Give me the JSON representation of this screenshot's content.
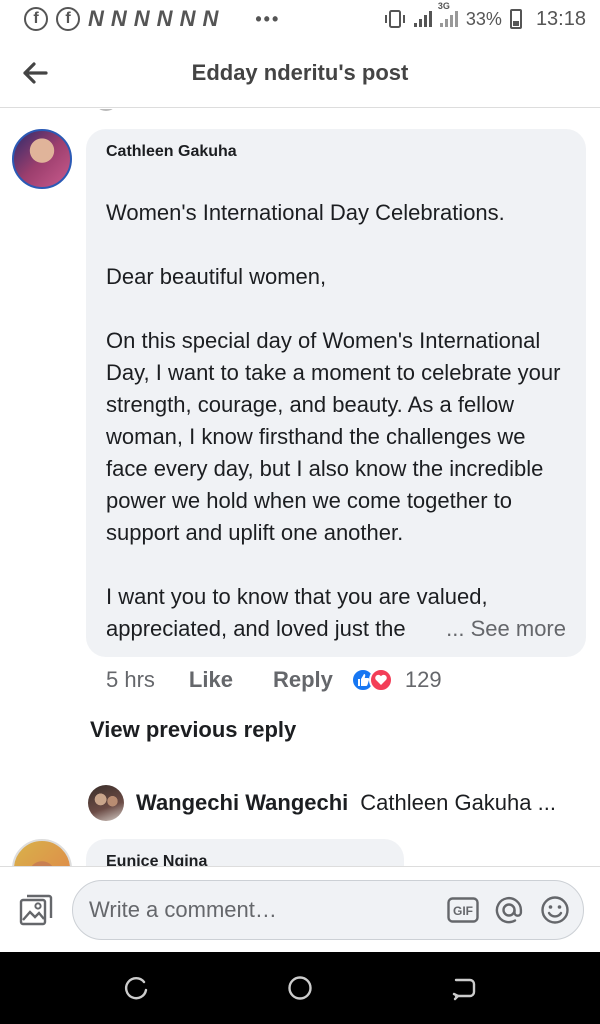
{
  "status_bar": {
    "battery": "33%",
    "time": "13:18",
    "network": "3G",
    "notification_glyphs": [
      "N",
      "N",
      "N",
      "N",
      "N",
      "N",
      "N"
    ]
  },
  "header": {
    "title": "Edday nderitu's post"
  },
  "comment": {
    "author": "Cathleen Gakuha",
    "text": "Women's International Day Celebrations.\n\nDear beautiful women,\n\nOn this special day of Women's International Day, I want to take a moment to celebrate your strength, courage, and beauty. As a fellow woman, I know firsthand the challenges we face every day, but I also know the incredible power we hold when we come together to support and uplift one another.\n\nI want you to know that you are valued, appreciated, and loved just the",
    "ellipsis": "...",
    "see_more": "See more",
    "time_ago": "5 hrs",
    "like_label": "Like",
    "reply_label": "Reply",
    "reaction_count": "129"
  },
  "view_previous_reply": "View previous reply",
  "reply": {
    "author": "Wangechi Wangechi",
    "snippet": "Cathleen Gakuha ..."
  },
  "next_comment": {
    "author": "Eunice Ngina"
  },
  "composer": {
    "placeholder": "Write a comment…",
    "gif_label": "GIF"
  },
  "colors": {
    "accent": "#1877f2",
    "love": "#f33e58",
    "bubble": "#f0f2f5",
    "muted_text": "#65676b"
  }
}
